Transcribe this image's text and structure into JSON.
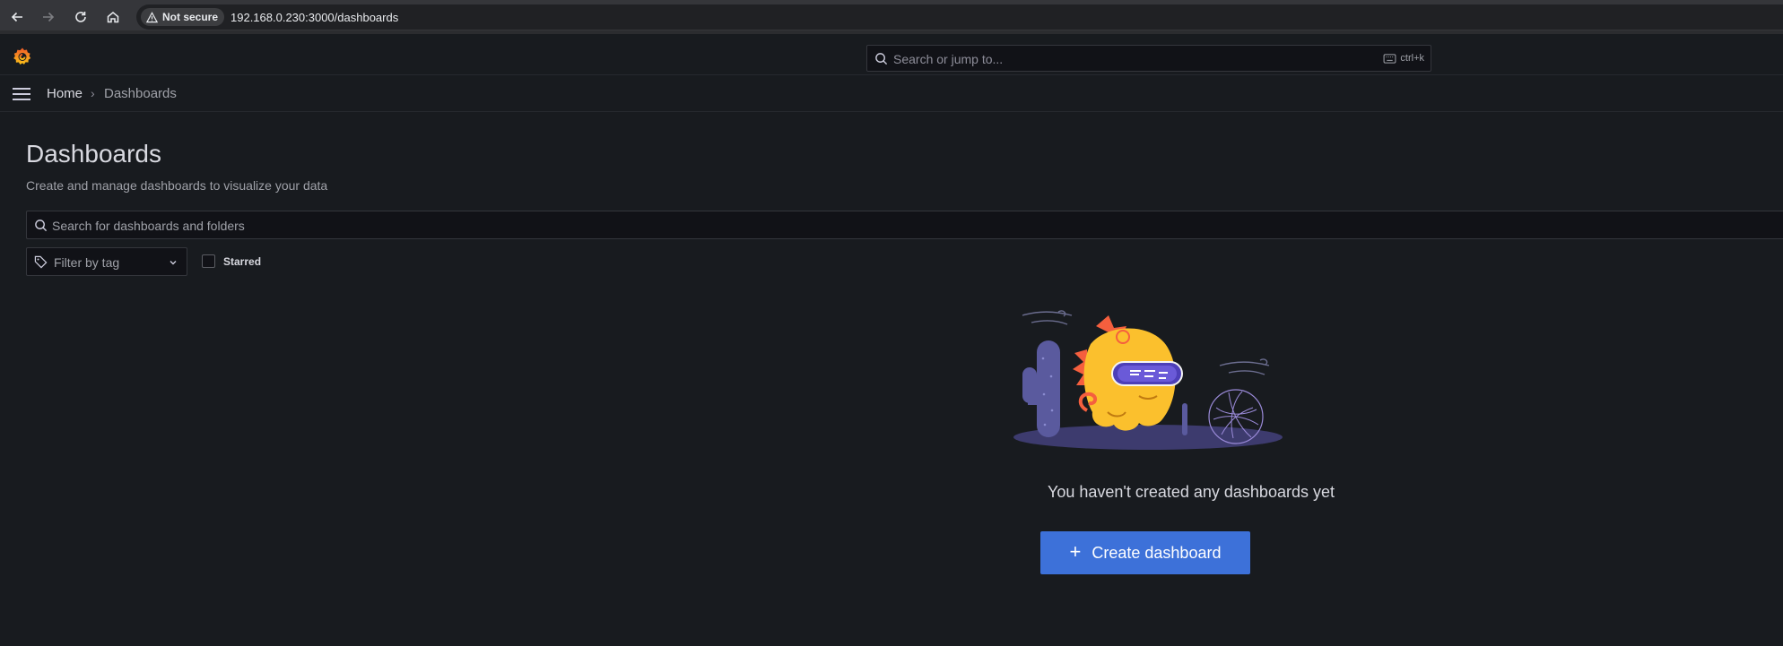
{
  "browser": {
    "security_label": "Not secure",
    "url": "192.168.0.230:3000/dashboards"
  },
  "topbar": {
    "search_placeholder": "Search or jump to...",
    "shortcut": "ctrl+k"
  },
  "breadcrumb": {
    "home": "Home",
    "separator": "›",
    "current": "Dashboards"
  },
  "page": {
    "title": "Dashboards",
    "subtitle": "Create and manage dashboards to visualize your data",
    "search_placeholder": "Search for dashboards and folders",
    "tag_filter_label": "Filter by tag",
    "starred_label": "Starred"
  },
  "empty_state": {
    "message": "You haven't created any dashboards yet",
    "button_icon": "+",
    "button_label": "Create dashboard"
  },
  "colors": {
    "background": "#181b1f",
    "primary_button": "#3d71d9",
    "brand_orange": "#f55f3e"
  }
}
